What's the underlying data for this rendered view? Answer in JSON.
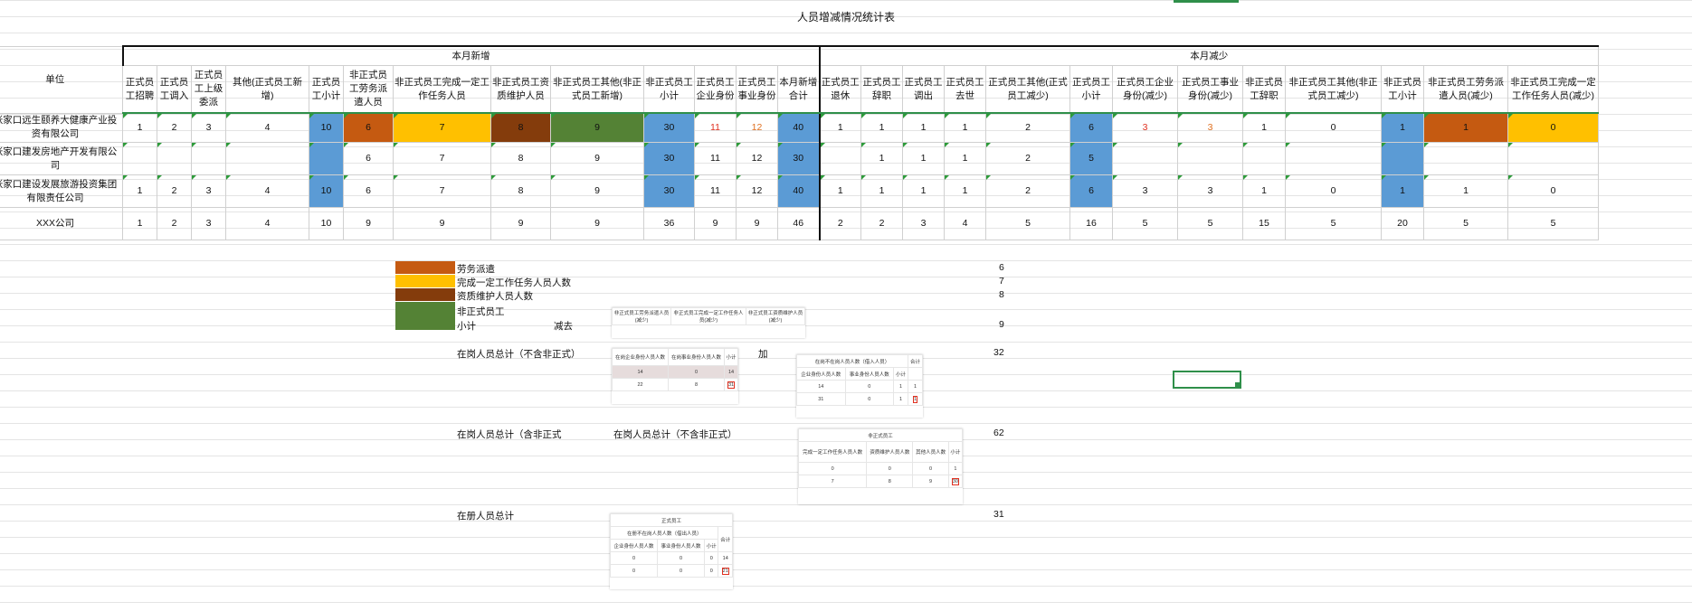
{
  "title": "人员增减情况统计表",
  "groups": {
    "add": "本月新增",
    "reduce": "本月减少"
  },
  "unit_header": "单位",
  "headers": [
    "正式员工招聘",
    "正式员工调入",
    "正式员工上级委派",
    "其他(正式员工新增)",
    "正式员工小计",
    "非正式员工劳务派遣人员",
    "非正式员工完成一定工作任务人员",
    "非正式员工资质维护人员",
    "非正式员工其他(非正式员工新增)",
    "非正式员工小计",
    "正式员工企业身份",
    "正式员工事业身份",
    "本月新增合计",
    "正式员工退休",
    "正式员工辞职",
    "正式员工调出",
    "正式员工去世",
    "正式员工其他(正式员工减少)",
    "正式员工小计",
    "正式员工企业身份(减少)",
    "正式员工事业身份(减少)",
    "非正式员工辞职",
    "非正式员工其他(非正式员工减少)",
    "非正式员工小计",
    "非正式员工劳务派遣人员(减少)",
    "非正式员工完成一定工作任务人员(减少)"
  ],
  "rows": [
    {
      "unit": "张家口远生颐养大健康产业投资有限公司",
      "vals": [
        "1",
        "2",
        "3",
        "4",
        "10",
        "6",
        "7",
        "8",
        "9",
        "30",
        "11",
        "12",
        "40",
        "1",
        "1",
        "1",
        "1",
        "2",
        "6",
        "3",
        "3",
        "1",
        "0",
        "1",
        "1",
        "0"
      ]
    },
    {
      "unit": "张家口建发房地产开发有限公司",
      "vals": [
        "",
        "",
        "",
        "",
        "",
        "6",
        "7",
        "8",
        "9",
        "30",
        "11",
        "12",
        "30",
        "",
        "1",
        "1",
        "1",
        "2",
        "5",
        "",
        "",
        "",
        "",
        "",
        "",
        ""
      ]
    },
    {
      "unit": "张家口建设发展旅游投资集团有限责任公司",
      "vals": [
        "1",
        "2",
        "3",
        "4",
        "10",
        "6",
        "7",
        "8",
        "9",
        "30",
        "11",
        "12",
        "40",
        "1",
        "1",
        "1",
        "1",
        "2",
        "6",
        "3",
        "3",
        "1",
        "0",
        "1",
        "1",
        "0"
      ]
    },
    {
      "unit": "XXX公司",
      "vals": [
        "1",
        "2",
        "3",
        "4",
        "10",
        "9",
        "9",
        "9",
        "9",
        "36",
        "9",
        "9",
        "46",
        "2",
        "2",
        "3",
        "4",
        "5",
        "16",
        "5",
        "5",
        "15",
        "5",
        "20",
        "5",
        "5"
      ]
    }
  ],
  "legend": [
    {
      "label": "劳务派遣",
      "value": "6",
      "color": "#c55a11"
    },
    {
      "label": "完成一定工作任务人员人数",
      "value": "7",
      "color": "#ffc000"
    },
    {
      "label": "资质维护人员人数",
      "value": "8",
      "color": "#843c0c"
    },
    {
      "label": "非正式员工",
      "value": "",
      "color": "#548235"
    }
  ],
  "notes": {
    "subtotal": "小计",
    "minus": "减去",
    "nine": "9",
    "onpost_excl": "在岗人员总计（不含非正式）",
    "add": "加",
    "v32": "32",
    "onpost_incl": "在岗人员总计（含非正式",
    "onpost_excl2": "在岗人员总计（不含非正式）",
    "v62": "62",
    "registered": "在册人员总计",
    "v31": "31"
  },
  "mini1": {
    "h": [
      "非正式员工劳务派遣人员(减少)",
      "非正式员工完成一定工作任务人员(减少)",
      "非正式员工资质维护人员(减少)"
    ]
  },
  "mini2": {
    "h": [
      "在岗企业身份人员人数",
      "在岗事业身份人员人数",
      "小计"
    ],
    "r1": [
      "14",
      "0",
      "14"
    ],
    "r2": [
      "22",
      "8",
      "31"
    ]
  },
  "mini3": {
    "t": "在岗不在岗人员人数（借入人员）",
    "tot": "合计",
    "h": [
      "企业身份人员人数",
      "事业身份人员人数",
      "小计"
    ],
    "r1": [
      "14",
      "0",
      "1",
      "1"
    ],
    "r2": [
      "31",
      "0",
      "1",
      "1"
    ]
  },
  "mini4": {
    "t": "非正式员工",
    "h": [
      "完成一定工作任务人员人数",
      "资质维护人员人数",
      "其他人员人数",
      "小计"
    ],
    "r1": [
      "0",
      "0",
      "0",
      "1"
    ],
    "r2": [
      "7",
      "8",
      "9",
      "30"
    ]
  },
  "mini5": {
    "t": "正式员工",
    "sub": "在册不在岗人员人数（借出人员）",
    "tot": "合计",
    "h": [
      "企业身份人员人数",
      "事业身份人员人数",
      "小计"
    ],
    "r1": [
      "0",
      "0",
      "0",
      "14"
    ],
    "r2": [
      "0",
      "0",
      "0",
      "21"
    ]
  }
}
